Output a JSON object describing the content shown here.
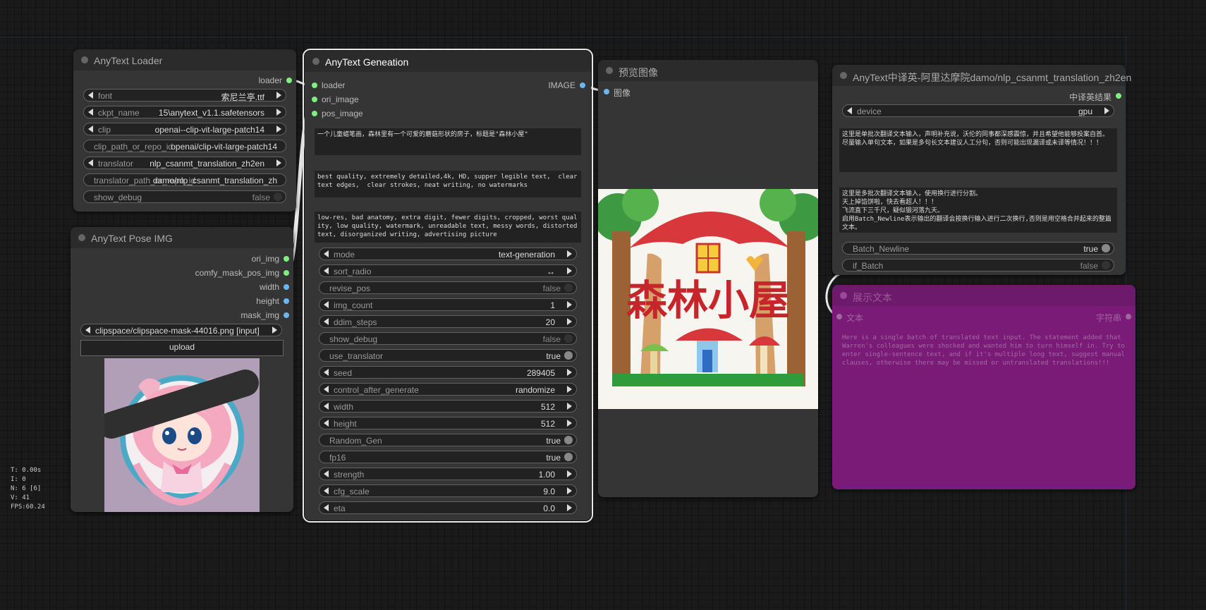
{
  "stats": {
    "t": "T: 0.00s",
    "i": "I: 0",
    "n": "N: 6 [6]",
    "v": "V: 41",
    "fps": "FPS:60.24"
  },
  "loader": {
    "title": "AnyText Loader",
    "output": "loader",
    "font": {
      "label": "font",
      "value": "索尼兰亭.ttf"
    },
    "ckpt_name": {
      "label": "ckpt_name",
      "value": "15\\anytext_v1.1.safetensors"
    },
    "clip": {
      "label": "clip",
      "value": "openai--clip-vit-large-patch14"
    },
    "clip_path": {
      "label": "clip_path_or_repo_id",
      "value": "openai/clip-vit-large-patch14"
    },
    "translator": {
      "label": "translator",
      "value": "nlp_csanmt_translation_zh2en"
    },
    "translator_path": {
      "label": "translator_path_or_repo_id",
      "value": "damo/nlp_csanmt_translation_zh"
    },
    "show_debug": {
      "label": "show_debug",
      "value": "false"
    }
  },
  "pose": {
    "title": "AnyText Pose IMG",
    "outputs": [
      "ori_img",
      "comfy_mask_pos_img",
      "width",
      "height",
      "mask_img"
    ],
    "image": {
      "label": "image",
      "value": "clipspace/clipspace-mask-44016.png [input]"
    },
    "upload": "upload"
  },
  "gen": {
    "title": "AnyText Geneation",
    "inputs": [
      "loader",
      "ori_image",
      "pos_image"
    ],
    "output": "IMAGE",
    "prompt": "一个儿童蜡笔画，森林里有一个可爱的蘑菇形状的房子，标题是\"森林小屋\"",
    "a_prompt": "best quality, extremely detailed,4k, HD, supper legible text,  clear text edges,  clear strokes, neat writing, no watermarks",
    "n_prompt": "low-res, bad anatomy, extra digit, fewer digits, cropped, worst quality, low quality, watermark, unreadable text, messy words, distorted text, disorganized writing, advertising picture",
    "widgets": {
      "mode": {
        "label": "mode",
        "value": "text-generation"
      },
      "sort_radio": {
        "label": "sort_radio",
        "value": "↔"
      },
      "revise_pos": {
        "label": "revise_pos",
        "value": "false"
      },
      "img_count": {
        "label": "img_count",
        "value": "1"
      },
      "ddim_steps": {
        "label": "ddim_steps",
        "value": "20"
      },
      "show_debug": {
        "label": "show_debug",
        "value": "false"
      },
      "use_translator": {
        "label": "use_translator",
        "value": "true"
      },
      "seed": {
        "label": "seed",
        "value": "289405"
      },
      "control_after_generate": {
        "label": "control_after_generate",
        "value": "randomize"
      },
      "width": {
        "label": "width",
        "value": "512"
      },
      "height": {
        "label": "height",
        "value": "512"
      },
      "random_gen": {
        "label": "Random_Gen",
        "value": "true"
      },
      "fp16": {
        "label": "fp16",
        "value": "true"
      },
      "strength": {
        "label": "strength",
        "value": "1.00"
      },
      "cfg_scale": {
        "label": "cfg_scale",
        "value": "9.0"
      },
      "eta": {
        "label": "eta",
        "value": "0.0"
      }
    }
  },
  "preview": {
    "title": "预览图像",
    "input": "图像",
    "image_text": "森林小屋"
  },
  "translate": {
    "title": "AnyText中译英-阿里达摩院damo/nlp_csanmt_translation_zh2en",
    "output": "中译英结果",
    "device": {
      "label": "device",
      "value": "gpu"
    },
    "text1": "这里是单批次翻译文本输入，声明补充说，沃伦的同事都深感震惊，并且希望他能够投案自首。尽量输入单句文本，如果是多句长文本建议人工分句，否则可能出现漏译或未译等情况！！！",
    "text2": "这里是多批次翻译文本输入，使用换行进行分割。\n天上掉馅饼啦，快去看超人！！！\n飞流直下三千尺，疑似银河落九天。\n启用Batch_Newline表示输出的翻译会按换行输入进行二次换行,否则是用空格合并起来的整篇文本。",
    "batch_newline": {
      "label": "Batch_Newline",
      "value": "true"
    },
    "if_batch": {
      "label": "if_Batch",
      "value": "false"
    }
  },
  "show": {
    "title": "展示文本",
    "input": "文本",
    "output": "字符串",
    "text": "Here is a single batch of translated text input. The statement added that Warren's colleagues were shocked and wanted him to turn himself in. Try to enter single-sentence text, and if it's multiple long text, suggest manual clauses, otherwise there may be missed or untranslated translations!!!"
  }
}
